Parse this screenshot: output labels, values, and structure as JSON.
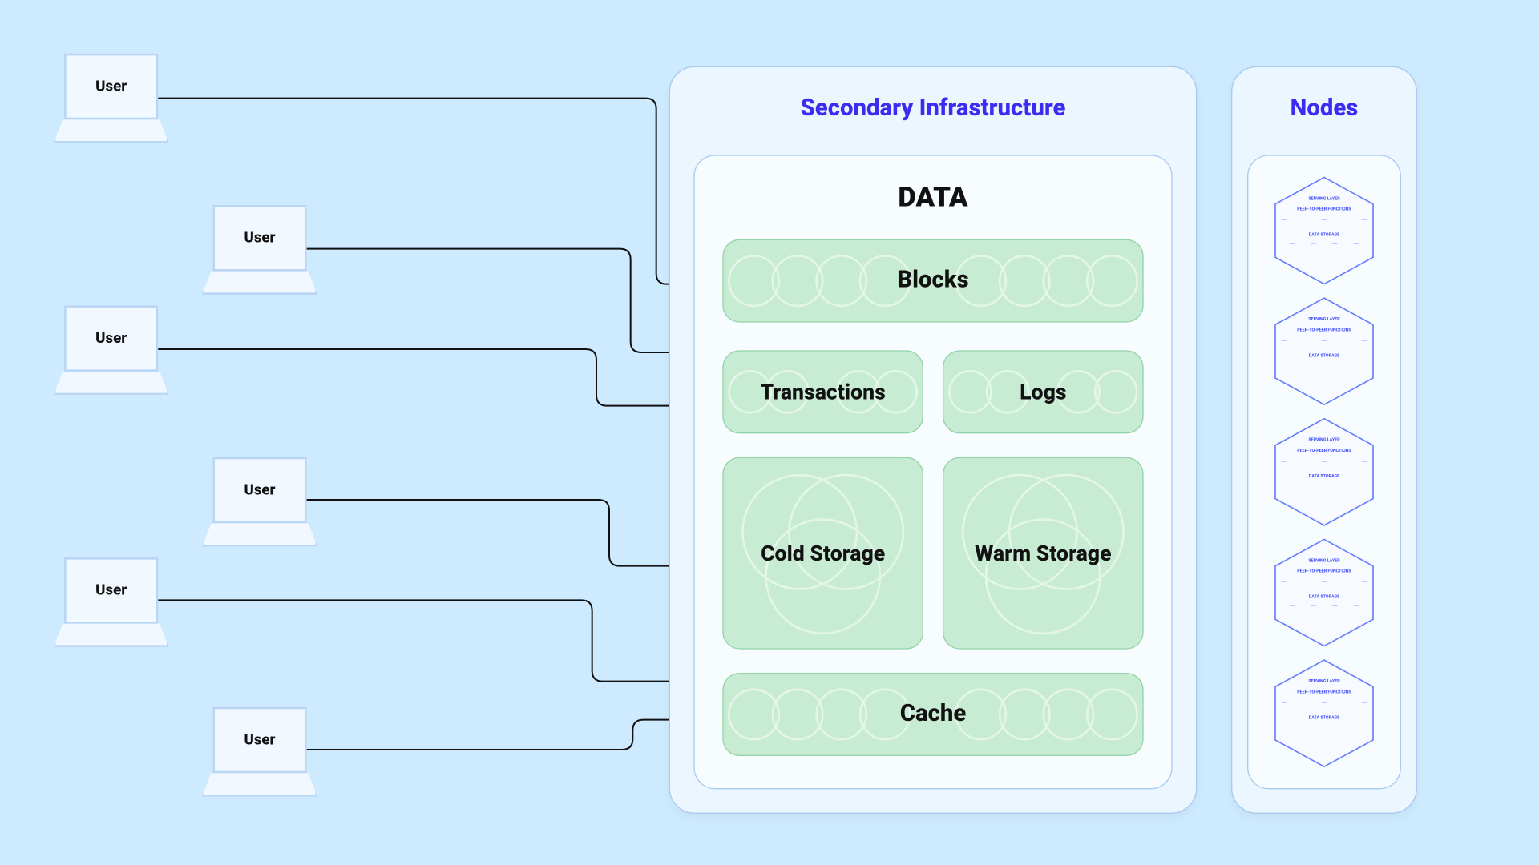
{
  "users": [
    {
      "label": "User"
    },
    {
      "label": "User"
    },
    {
      "label": "User"
    },
    {
      "label": "User"
    },
    {
      "label": "User"
    },
    {
      "label": "User"
    }
  ],
  "secondary": {
    "title": "Secondary Infrastructure",
    "data_title": "DATA",
    "boxes": {
      "blocks": "Blocks",
      "transactions": "Transactions",
      "logs": "Logs",
      "cold": "Cold Storage",
      "warm": "Warm Storage",
      "cache": "Cache"
    }
  },
  "nodes": {
    "title": "Nodes",
    "hex_labels": {
      "serving": "SERVING LAYER",
      "p2p": "PEER-TO-PEER FUNCTIONS",
      "storage": "DATA STORAGE"
    },
    "count": 5
  }
}
